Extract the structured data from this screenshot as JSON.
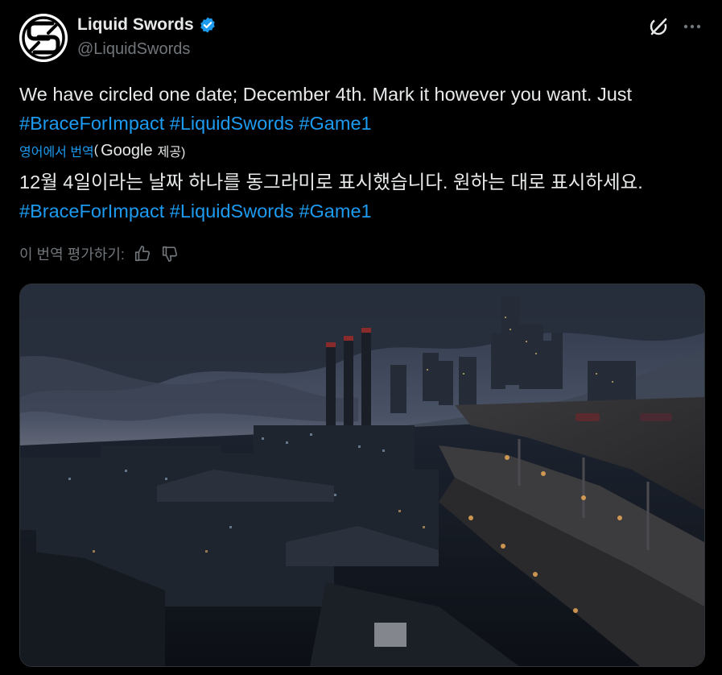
{
  "author": {
    "display_name": "Liquid Swords",
    "handle": "@LiquidSwords",
    "avatar_icon": "liquid-swords-logo",
    "verified_icon": "verified-badge-icon",
    "verified_color": "#1d9bf0"
  },
  "header_actions": {
    "grok_icon": "grok-icon",
    "more_icon": "more-dots-icon"
  },
  "tweet": {
    "text_line1": "We have circled one date; December 4th. Mark it however you want. Just",
    "hashtags": [
      "#BraceForImpact",
      "#LiquidSwords",
      "#Game1"
    ]
  },
  "translation": {
    "link_label": "영어에서 번역",
    "open_paren": "(",
    "provider": "Google",
    "provided_suffix": "제공)",
    "text_line1": "12월 4일이라는 날짜 하나를 동그라미로 표시했습니다. 원하는 대로 표시하세요.",
    "hashtags": [
      "#BraceForImpact",
      "#LiquidSwords",
      "#Game1"
    ]
  },
  "rating": {
    "label": "이 번역 평가하기:",
    "thumbs_up_icon": "thumbs-up-icon",
    "thumbs_down_icon": "thumbs-down-icon"
  },
  "media": {
    "type": "image",
    "subject": "industrial-city-night-scene"
  },
  "colors": {
    "background": "#000000",
    "text": "#e7e9ea",
    "secondary": "#71767b",
    "link": "#1d9bf0"
  }
}
